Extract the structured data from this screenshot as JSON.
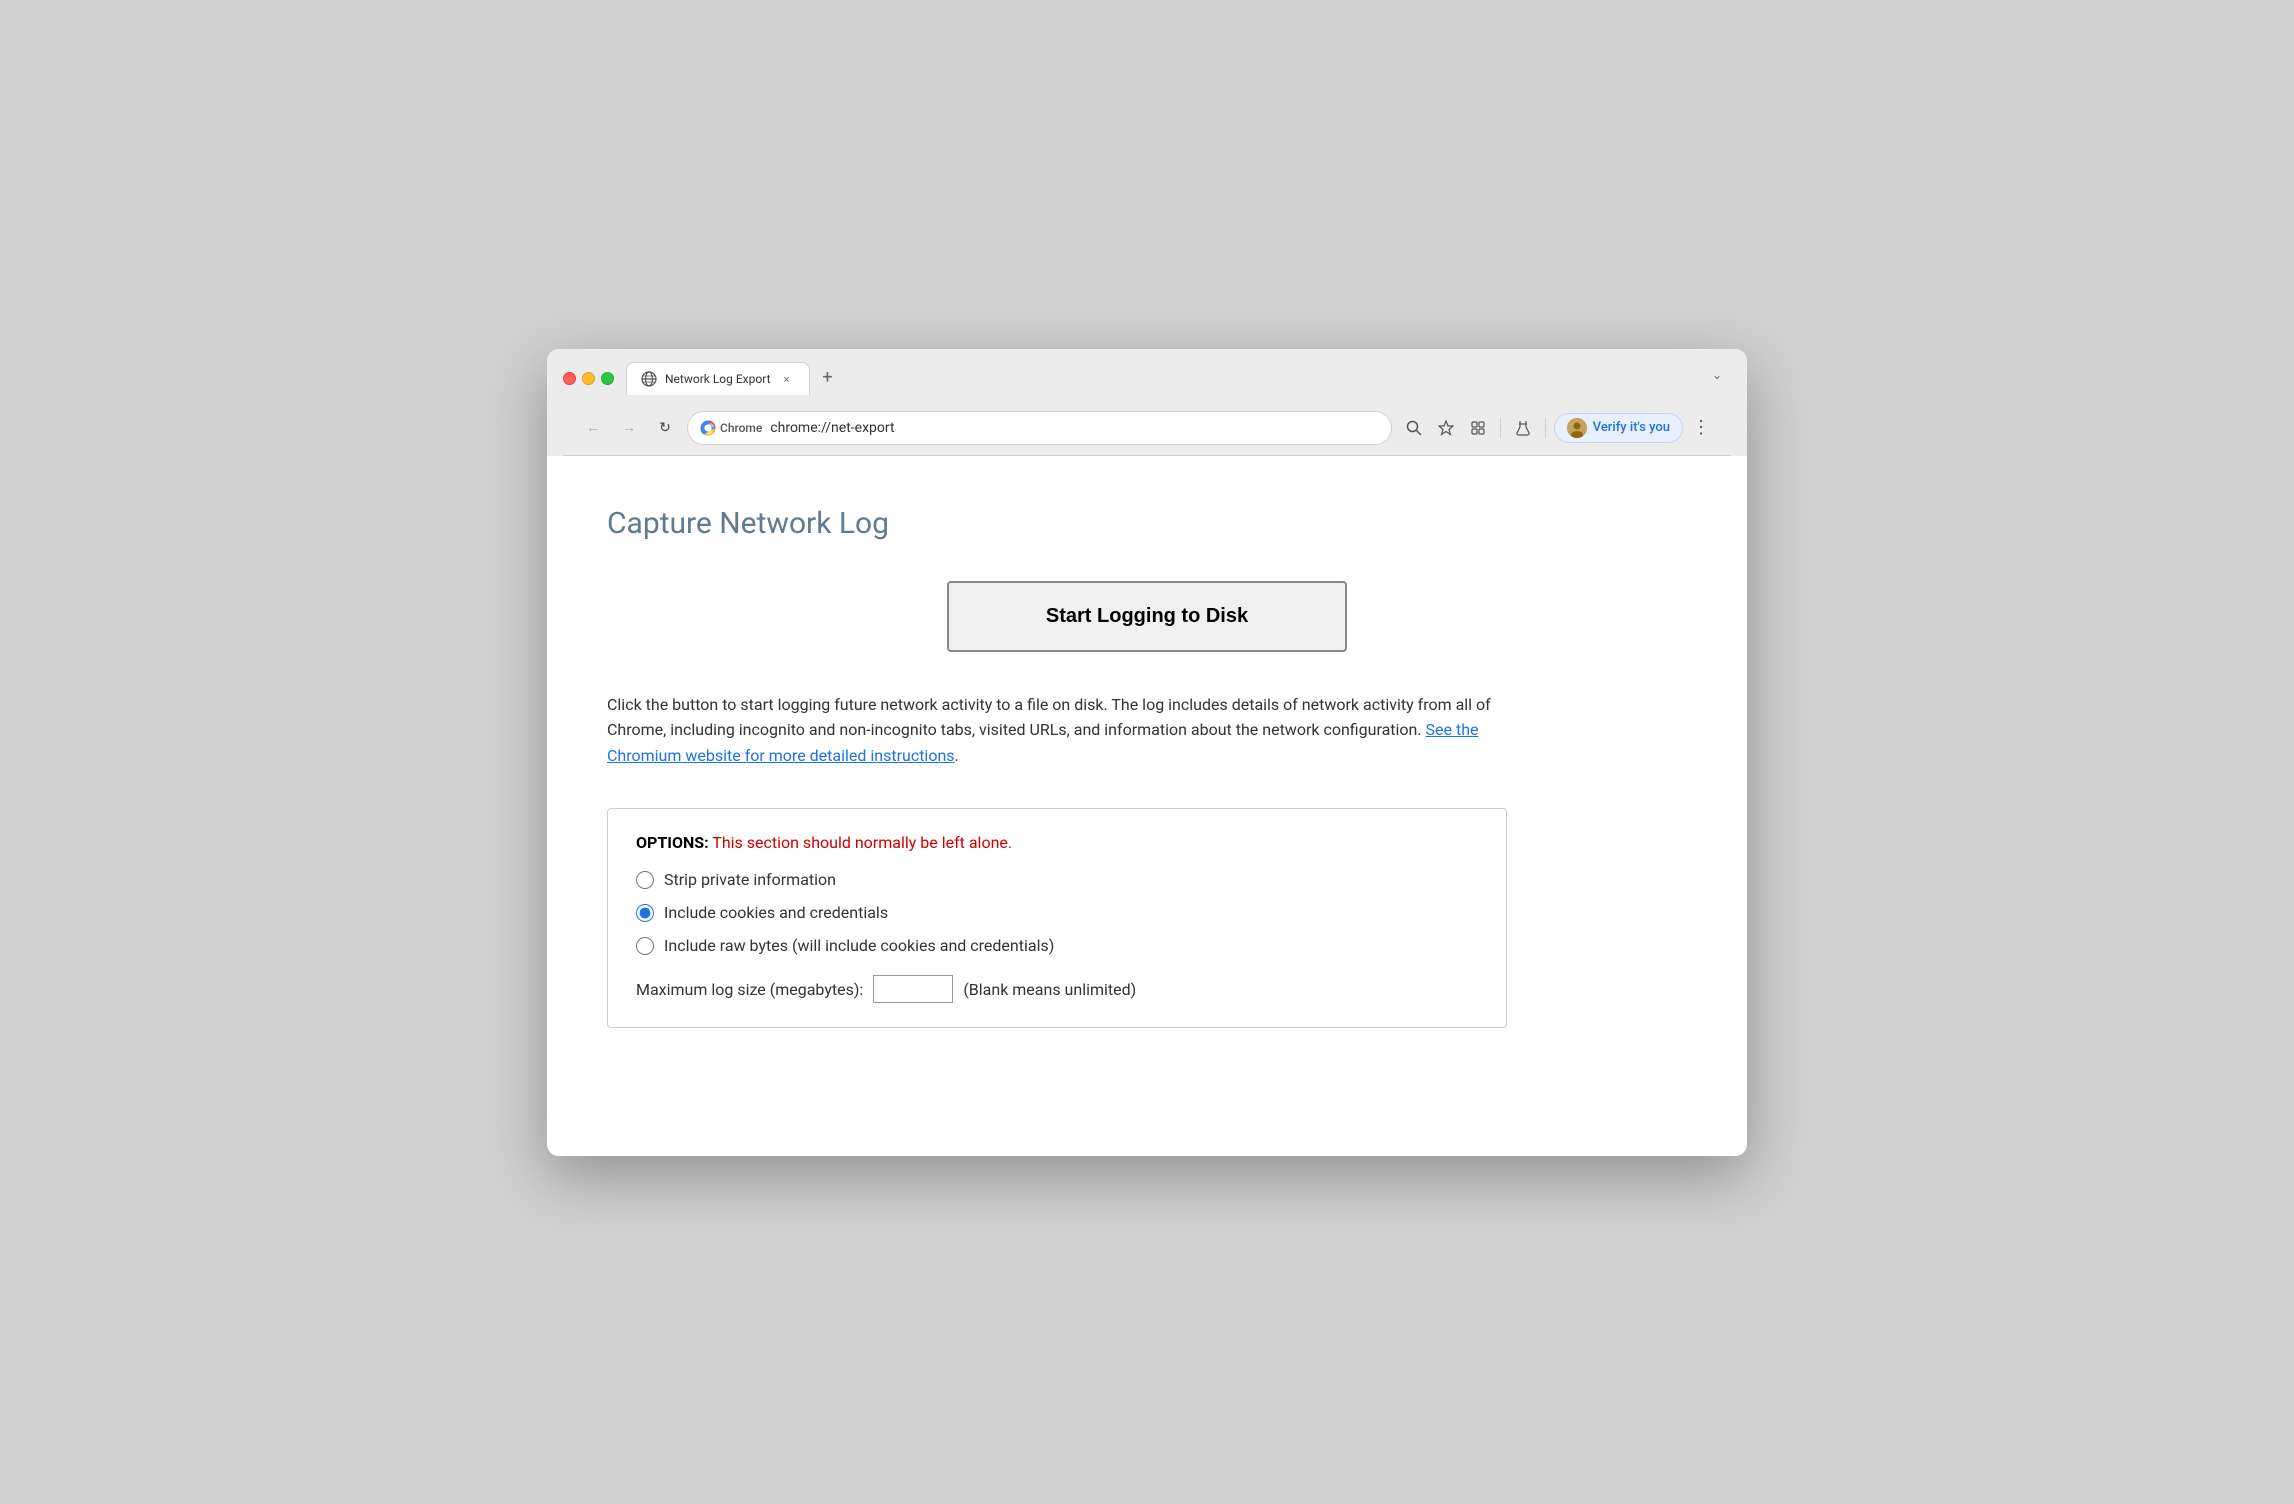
{
  "browser": {
    "tab": {
      "title": "Network Log Export",
      "close_label": "×"
    },
    "new_tab_label": "+",
    "chevron_label": "⌄",
    "nav": {
      "back_label": "←",
      "forward_label": "→",
      "reload_label": "↻"
    },
    "address_bar": {
      "site_name": "Chrome",
      "url": "chrome://net-export"
    },
    "toolbar_icons": {
      "search": "🔍",
      "star": "☆",
      "extension": "🧩",
      "flask": "⚗"
    },
    "verify_button": {
      "label": "Verify it's you"
    },
    "menu_label": "⋮"
  },
  "page": {
    "title": "Capture Network Log",
    "start_button_label": "Start Logging to Disk",
    "description_before_link": "Click the button to start logging future network activity to a file on disk. The log includes details of network activity from all of Chrome, including incognito and non-incognito tabs, visited URLs, and information about the network configuration. ",
    "description_link_text": "See the Chromium website for more detailed instructions",
    "description_after_link": ".",
    "options": {
      "header_label": "OPTIONS:",
      "warning_text": " This section should normally be left alone.",
      "radio_options": [
        {
          "id": "strip",
          "label": "Strip private information",
          "checked": false
        },
        {
          "id": "cookies",
          "label": "Include cookies and credentials",
          "checked": true
        },
        {
          "id": "raw",
          "label": "Include raw bytes (will include cookies and credentials)",
          "checked": false
        }
      ],
      "max_size_label": "Maximum log size (megabytes):",
      "max_size_value": "",
      "max_size_hint": "(Blank means unlimited)"
    }
  },
  "colors": {
    "accent": "#1a73e8",
    "warning": "#cc0000",
    "page_title": "#5f7b8c"
  }
}
